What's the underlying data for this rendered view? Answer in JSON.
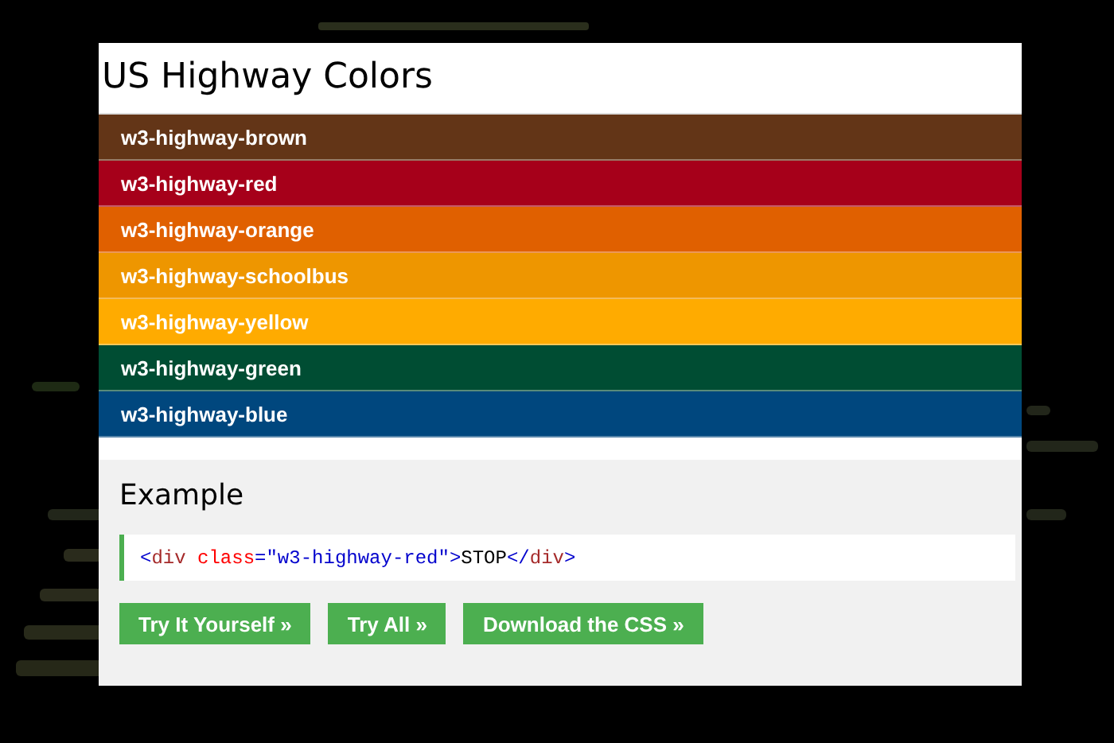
{
  "title": "US Highway Colors",
  "colors": [
    {
      "label": "w3-highway-brown",
      "color": "#633517"
    },
    {
      "label": "w3-highway-red",
      "color": "#a6001a"
    },
    {
      "label": "w3-highway-orange",
      "color": "#e06000"
    },
    {
      "label": "w3-highway-schoolbus",
      "color": "#ee9600"
    },
    {
      "label": "w3-highway-yellow",
      "color": "#ffab00"
    },
    {
      "label": "w3-highway-green",
      "color": "#004d33"
    },
    {
      "label": "w3-highway-blue",
      "color": "#00477e"
    }
  ],
  "example": {
    "heading": "Example",
    "code": [
      {
        "kind": "bracket",
        "text": "<"
      },
      {
        "kind": "tag",
        "text": "div"
      },
      {
        "kind": "attr",
        "text": " class"
      },
      {
        "kind": "value",
        "text": "=\"w3-highway-red\""
      },
      {
        "kind": "bracket",
        "text": ">"
      },
      {
        "kind": "text",
        "text": "STOP"
      },
      {
        "kind": "bracket",
        "text": "</"
      },
      {
        "kind": "tag",
        "text": "div"
      },
      {
        "kind": "bracket",
        "text": ">"
      }
    ],
    "buttons": [
      "Try It Yourself »",
      "Try All »",
      "Download the CSS »"
    ]
  }
}
